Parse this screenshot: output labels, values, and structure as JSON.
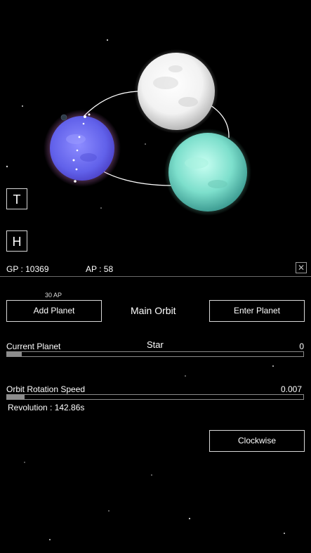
{
  "hud": {
    "t_button": "T",
    "h_button": "H",
    "gp": "GP : 10369",
    "ap": "AP : 58",
    "close_icon": "✕"
  },
  "panel": {
    "add_planet_cost": "30 AP",
    "add_planet_label": "Add Planet",
    "orbit_title": "Main Orbit",
    "enter_planet_label": "Enter Planet",
    "current_planet_label": "Current Planet",
    "current_planet_name": "Star",
    "current_planet_value": "0",
    "current_planet_fill": 0.05,
    "orbit_speed_label": "Orbit Rotation Speed",
    "orbit_speed_value": "0.007",
    "orbit_speed_fill": 0.06,
    "revolution": "Revolution : 142.86s",
    "direction_label": "Clockwise"
  },
  "colors": {
    "background": "#000000",
    "star_white": "#ffffff",
    "star_blue": "#6f6ff2",
    "star_teal": "#7fe6d4",
    "bar_fill": "#8c8c8c"
  }
}
